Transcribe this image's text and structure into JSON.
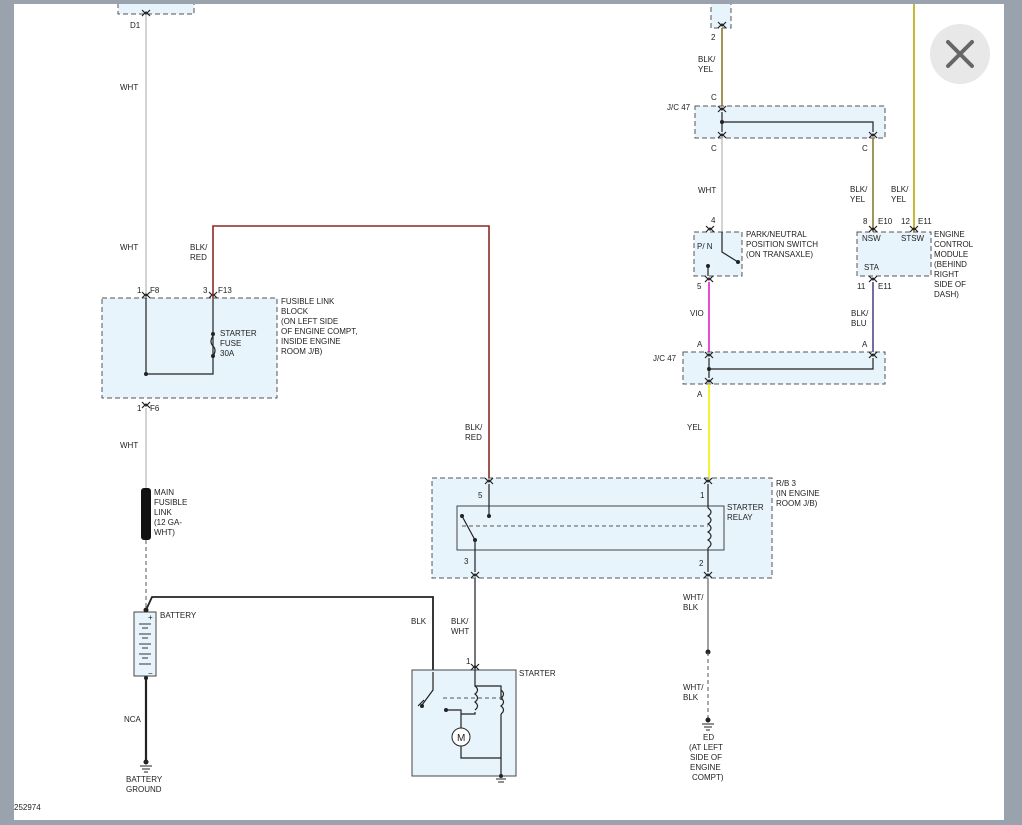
{
  "window": {
    "close_icon": "close-icon"
  },
  "diagram_id": "252974",
  "wires": {
    "d1_wht_top": "WHT",
    "d1_wht_mid": "WHT",
    "f6_wht": "WHT",
    "f13_blk_red": "BLK/\nRED",
    "relay5_blk_red": "BLK/\nRED",
    "battery_blk": "BLK",
    "starter_blk_wht": "BLK/\nWHT",
    "batt_ground_nca": "NCA",
    "jc_top_blk_yel": "BLK/\nYEL",
    "jc_c_wht": "WHT",
    "jc_c_blk_yel": "BLK/\nYEL",
    "ecm_blk_yel_12": "BLK/\nYEL",
    "park_vio": "VIO",
    "ecm_blk_blu": "BLK/\nBLU",
    "jc_a_yel": "YEL",
    "relay2_wht_blk": "WHT/\nBLK",
    "ground_wht_blk": "WHT/\nBLK"
  },
  "components": {
    "d1": "D1",
    "fusible_link_block": "FUSIBLE LINK\nBLOCK\n(ON LEFT SIDE\nOF ENGINE COMPT,\nINSIDE ENGINE\nROOM J/B)",
    "starter_fuse": "STARTER\nFUSE\n30A",
    "main_fusible_link": "MAIN\nFUSIBLE\nLINK\n(12 GA-\nWHT)",
    "battery": "BATTERY",
    "battery_ground": "BATTERY\nGROUND",
    "starter": "STARTER",
    "motor": "M",
    "rb3": "R/B 3\n(IN ENGINE\nROOM J/B)",
    "starter_relay": "STARTER\nRELAY",
    "jc47_top": "J/C 47",
    "jc47_bottom": "J/C 47",
    "park_neutral_switch": "PARK/NEUTRAL\nPOSITION SWITCH\n(ON TRANSAXLE)",
    "pn_contacts": "P/   N",
    "ecm": "ENGINE\nCONTROL\nMODULE\n(BEHIND\nRIGHT\nSIDE OF\nDASH)",
    "ecm_nsw": "NSW",
    "ecm_stsw": "STSW",
    "ecm_sta": "STA",
    "ed_ground": "ED\n(AT LEFT\nSIDE OF\nENGINE\nCOMPT)"
  },
  "pins": {
    "f8_pin": "1",
    "f8": "F8",
    "f13_pin": "3",
    "f13": "F13",
    "f6_pin": "1",
    "f6": "F6",
    "relay_5": "5",
    "relay_1": "1",
    "relay_3": "3",
    "relay_2": "2",
    "starter_1": "1",
    "top_2": "2",
    "jc_c1": "C",
    "jc_c2": "C",
    "jc_c3": "C",
    "pn_4": "4",
    "pn_5": "5",
    "e10_pin": "8",
    "e10": "E10",
    "e11_pin": "12",
    "e11": "E11",
    "e11b_pin": "11",
    "e11b": "E11",
    "jc_a1": "A",
    "jc_a2": "A",
    "jc_a3": "A",
    "batt_plus": "+",
    "batt_minus": "−"
  },
  "colors": {
    "wht": "#c8c8c8",
    "blk": "#1a1a1a",
    "blk_red": "#8b2a22",
    "blk_yel": "#8a7b2c",
    "vio": "#e01ed0",
    "yel": "#f2ee00",
    "blk_blu": "#4c4a8c",
    "box_fill": "#e8f4fb"
  }
}
